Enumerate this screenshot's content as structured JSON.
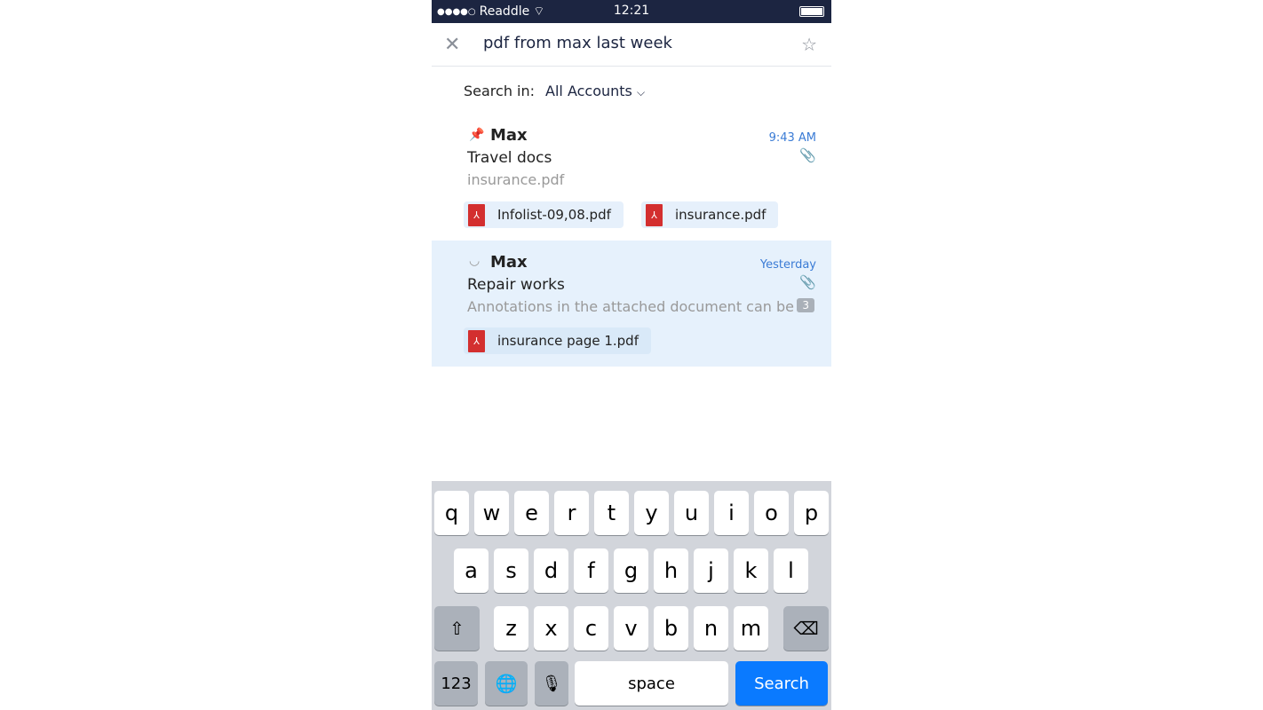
{
  "status": {
    "signal": "●●●●○",
    "carrier": "Readdle",
    "time": "12:21"
  },
  "search": {
    "query": "pdf from max last week",
    "search_in_label": "Search in:",
    "account": "All Accounts"
  },
  "messages": [
    {
      "from": "Max",
      "time": "9:43 AM",
      "subject": "Travel docs",
      "preview": "insurance.pdf",
      "attachments": [
        "Infolist-09,08.pdf",
        "insurance.pdf"
      ],
      "icon": "pin-icon"
    },
    {
      "from": "Max",
      "time": "Yesterday",
      "subject": "Repair works",
      "preview": "Annotations in the attached document can be",
      "count": "3",
      "attachments": [
        "insurance page 1.pdf"
      ],
      "icon": "person-icon"
    }
  ],
  "keyboard": {
    "row1": [
      "q",
      "w",
      "e",
      "r",
      "t",
      "y",
      "u",
      "i",
      "o",
      "p"
    ],
    "row2": [
      "a",
      "s",
      "d",
      "f",
      "g",
      "h",
      "j",
      "k",
      "l"
    ],
    "row3": [
      "z",
      "x",
      "c",
      "v",
      "b",
      "n",
      "m"
    ],
    "numbers": "123",
    "space": "space",
    "search": "Search"
  },
  "colors": {
    "status_bar": "#1c2541",
    "accent": "#3a7bd5",
    "search_key": "#0a7aff",
    "pdf": "#d32f2f",
    "highlight": "#e6f1fc"
  }
}
